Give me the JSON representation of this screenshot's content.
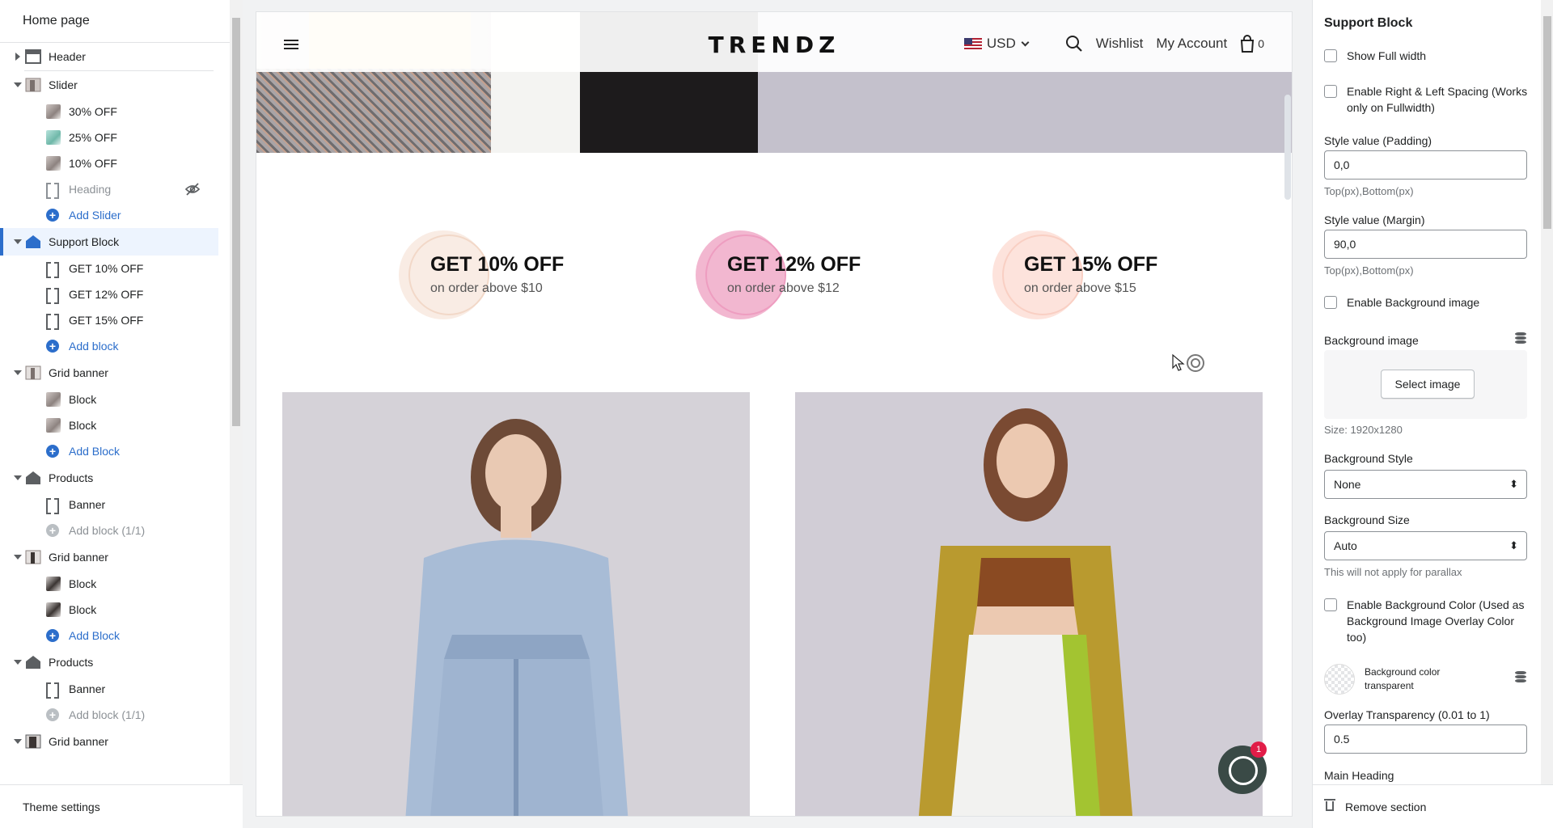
{
  "left_panel": {
    "title": "Home page",
    "sections": [
      {
        "label": "Header",
        "expanded": false,
        "children": []
      },
      {
        "label": "Slider",
        "expanded": true,
        "children": [
          {
            "label": "30% OFF",
            "kind": "thumb"
          },
          {
            "label": "25% OFF",
            "kind": "thumb"
          },
          {
            "label": "10% OFF",
            "kind": "thumb"
          },
          {
            "label": "Heading",
            "kind": "block",
            "hidden": true
          },
          {
            "label": "Add Slider",
            "kind": "add"
          }
        ]
      },
      {
        "label": "Support Block",
        "expanded": true,
        "selected": true,
        "children": [
          {
            "label": "GET 10% OFF",
            "kind": "block"
          },
          {
            "label": "GET 12% OFF",
            "kind": "block"
          },
          {
            "label": "GET 15% OFF",
            "kind": "block"
          },
          {
            "label": "Add block",
            "kind": "add"
          }
        ]
      },
      {
        "label": "Grid banner",
        "expanded": true,
        "children": [
          {
            "label": "Block",
            "kind": "thumb"
          },
          {
            "label": "Block",
            "kind": "thumb"
          },
          {
            "label": "Add Block",
            "kind": "add"
          }
        ]
      },
      {
        "label": "Products",
        "expanded": true,
        "children": [
          {
            "label": "Banner",
            "kind": "block"
          },
          {
            "label": "Add block (1/1)",
            "kind": "add-disabled"
          }
        ]
      },
      {
        "label": "Grid banner",
        "expanded": true,
        "children": [
          {
            "label": "Block",
            "kind": "thumb"
          },
          {
            "label": "Block",
            "kind": "thumb"
          },
          {
            "label": "Add Block",
            "kind": "add"
          }
        ]
      },
      {
        "label": "Products",
        "expanded": true,
        "children": [
          {
            "label": "Banner",
            "kind": "block"
          },
          {
            "label": "Add block (1/1)",
            "kind": "add-disabled"
          }
        ]
      },
      {
        "label": "Grid banner",
        "expanded": true,
        "children": []
      }
    ],
    "footer": "Theme settings"
  },
  "preview": {
    "logo": "TRENDZ",
    "currency": "USD",
    "wishlist": "Wishlist",
    "account": "My Account",
    "cart_count": "0",
    "offers": [
      {
        "title": "GET 10% OFF",
        "subtitle": "on order above $10",
        "color": "#f9ece4",
        "ring": "#f2d8c8"
      },
      {
        "title": "GET 12% OFF",
        "subtitle": "on order above $12",
        "color": "#f2b7d0",
        "ring": "#ee9dc0"
      },
      {
        "title": "GET 15% OFF",
        "subtitle": "on order above $15",
        "color": "#fde3dc",
        "ring": "#f9cfc3"
      }
    ],
    "chat_badge": "1"
  },
  "right_panel": {
    "title": "Support Block",
    "show_full_width": "Show Full width",
    "enable_spacing": "Enable Right & Left Spacing (Works only on Fullwidth)",
    "padding_label": "Style value (Padding)",
    "padding_value": "0,0",
    "padding_help": "Top(px),Bottom(px)",
    "margin_label": "Style value (Margin)",
    "margin_value": "90,0",
    "margin_help": "Top(px),Bottom(px)",
    "enable_bg_image": "Enable Background image",
    "bg_image_label": "Background image",
    "select_image": "Select image",
    "size_note": "Size: 1920x1280",
    "bg_style_label": "Background Style",
    "bg_style_value": "None",
    "bg_size_label": "Background Size",
    "bg_size_value": "Auto",
    "bg_size_help": "This will not apply for parallax",
    "enable_bg_color": "Enable Background Color (Used as Background Image Overlay Color too)",
    "bg_color_label": "Background color",
    "bg_color_value": "transparent",
    "overlay_label": "Overlay Transparency (0.01 to 1)",
    "overlay_value": "0.5",
    "main_heading_label": "Main Heading",
    "remove_section": "Remove section"
  }
}
